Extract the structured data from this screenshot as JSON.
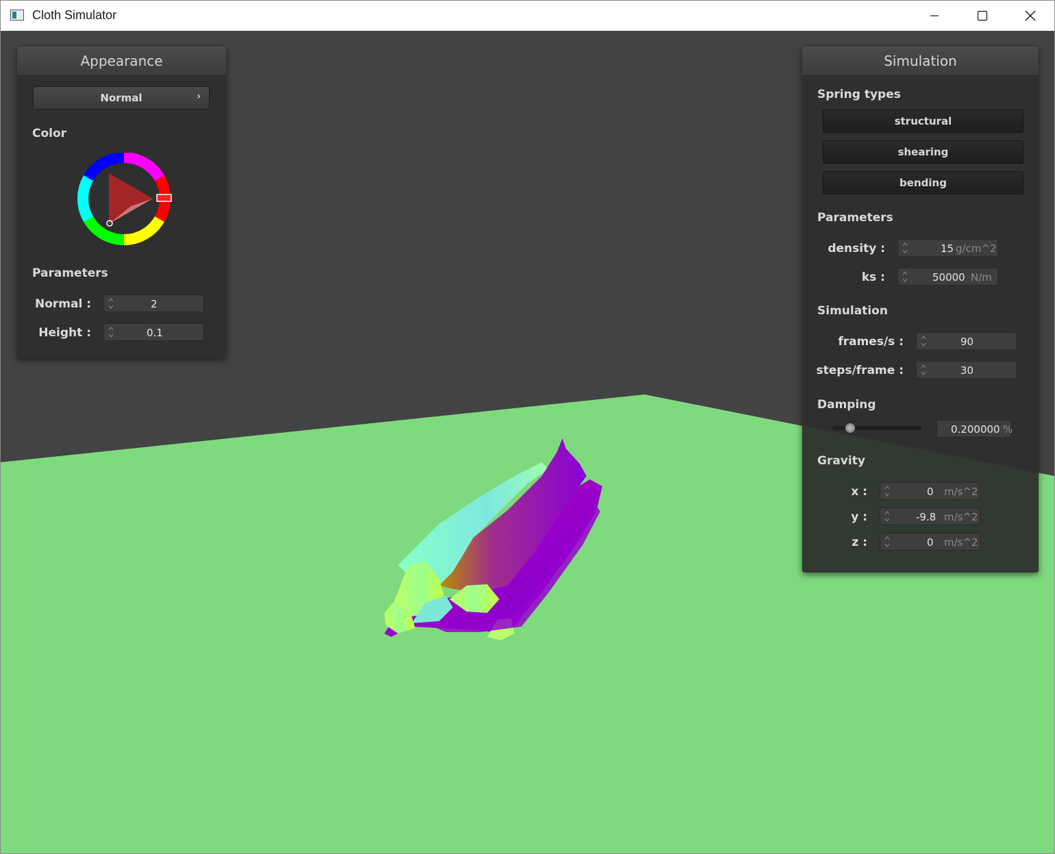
{
  "window": {
    "title": "Cloth Simulator"
  },
  "appearance": {
    "title": "Appearance",
    "shader": "Normal",
    "color_label": "Color",
    "parameters_label": "Parameters",
    "normal_label": "Normal :",
    "normal_value": "2",
    "height_label": "Height :",
    "height_value": "0.1",
    "selected_color": "#ff0000"
  },
  "simulation": {
    "title": "Simulation",
    "spring_types_label": "Spring types",
    "spring_buttons": [
      "structural",
      "shearing",
      "bending"
    ],
    "parameters_label": "Parameters",
    "density_label": "density :",
    "density_value": "15",
    "density_unit": "g/cm^2",
    "ks_label": "ks :",
    "ks_value": "50000",
    "ks_unit": "N/m",
    "sim_label": "Simulation",
    "fps_label": "frames/s :",
    "fps_value": "90",
    "steps_label": "steps/frame :",
    "steps_value": "30",
    "damping_label": "Damping",
    "damping_value": "0.200000",
    "damping_unit": "%",
    "damping_slider": 0.2,
    "gravity_label": "Gravity",
    "gx_label": "x :",
    "gx_value": "0",
    "gy_label": "y :",
    "gy_value": "-9.8",
    "gz_label": "z :",
    "gz_value": "0",
    "gravity_unit": "m/s^2"
  },
  "colors": {
    "floor": "#7fd97f",
    "background": "#434343",
    "panel": "#2e2e2e"
  }
}
